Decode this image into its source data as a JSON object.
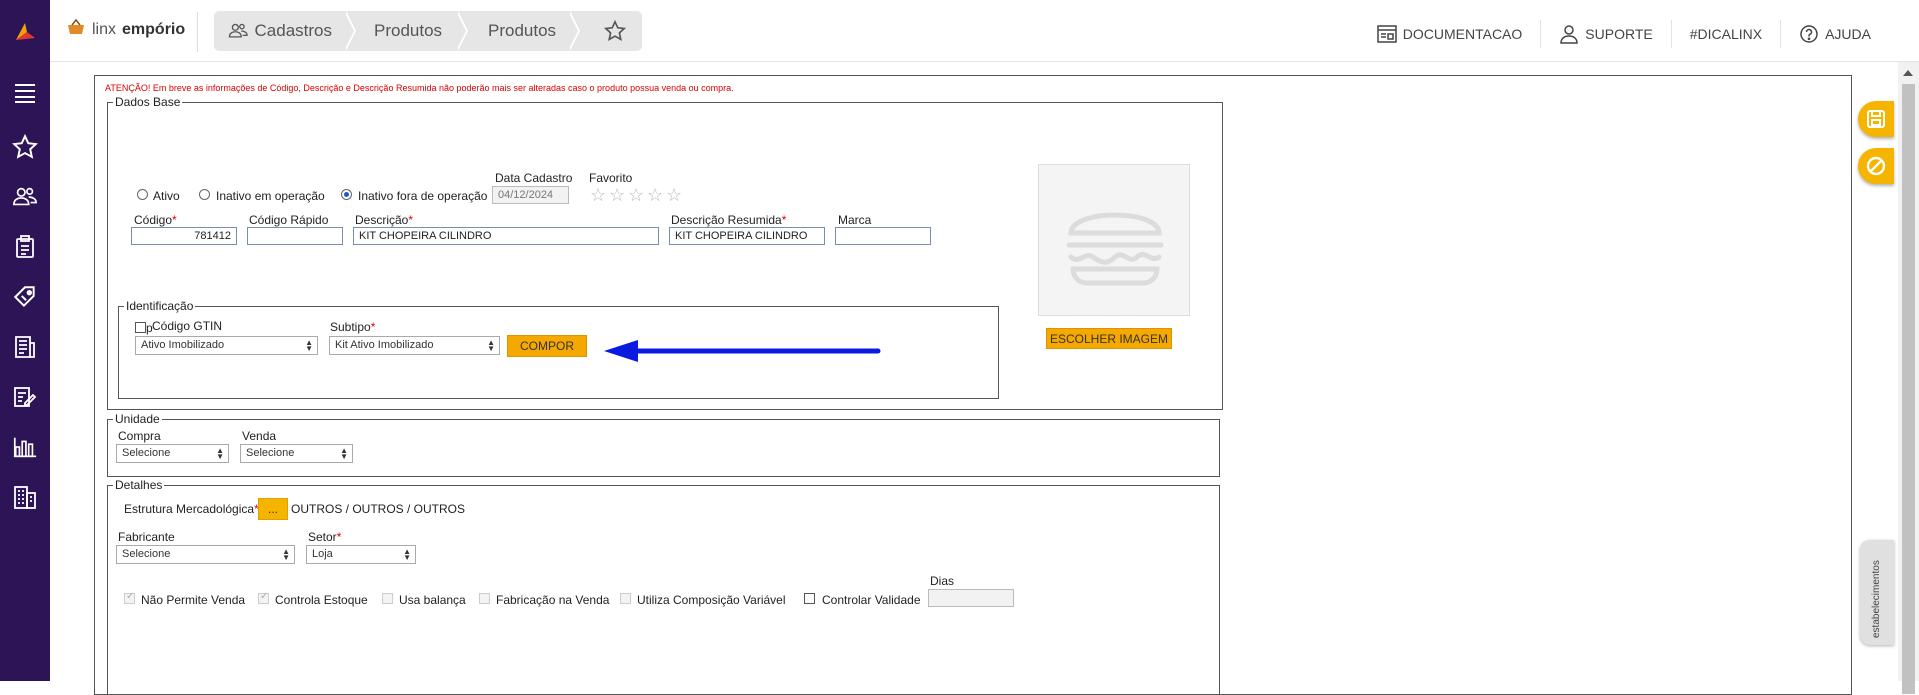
{
  "brand": {
    "name1": "linx",
    "name2": "empório"
  },
  "breadcrumbs": [
    "Cadastros",
    "Produtos",
    "Produtos"
  ],
  "top_actions": [
    "DOCUMENTACAO",
    "SUPORTE",
    "#DICALINX",
    "AJUDA"
  ],
  "sidebar": {
    "icons": [
      "menu-icon",
      "star-icon",
      "users-icon",
      "clipboard-icon",
      "tag-icon",
      "receipt-icon",
      "edit-form-icon",
      "bar-chart-icon",
      "building-icon"
    ]
  },
  "warning": "ATENÇÃO! Em breve as informações de Código, Descrição e Descrição Resumida não poderão mais ser alteradas caso o produto possua venda ou compra.",
  "dados_base": {
    "legend": "Dados Base",
    "status_options": [
      "Ativo",
      "Inativo em operação",
      "Inativo fora de operação"
    ],
    "status_selected": "Inativo fora de operação",
    "data_cadastro_label": "Data Cadastro",
    "data_cadastro_value": "04/12/2024",
    "favorito_label": "Favorito",
    "favorito_rating": 0,
    "codigo_label": "Código",
    "codigo_value": "781412",
    "codigo_rapido_label": "Código Rápido",
    "codigo_rapido_value": "",
    "descricao_label": "Descrição",
    "descricao_value": "KIT CHOPEIRA CILINDRO",
    "descricao_resumida_label": "Descrição Resumida",
    "descricao_resumida_value": "KIT CHOPEIRA CILINDRO",
    "marca_label": "Marca",
    "marca_value": "",
    "escolher_imagem": "ESCOLHER IMAGEM"
  },
  "identificacao": {
    "legend": "Identificação",
    "gtin_label": "Código GTIN",
    "gtin_overlap": "p",
    "tipo_value": "Ativo Imobilizado",
    "subtipo_label": "Subtipo",
    "subtipo_value": "Kit Ativo Imobilizado",
    "compor_label": "COMPOR"
  },
  "unidade": {
    "legend": "Unidade",
    "compra_label": "Compra",
    "compra_value": "Selecione",
    "venda_label": "Venda",
    "venda_value": "Selecione"
  },
  "detalhes": {
    "legend": "Detalhes",
    "estrutura_label": "Estrutura Mercadológica",
    "estrutura_btn": "...",
    "estrutura_value": "OUTROS / OUTROS / OUTROS",
    "fabricante_label": "Fabricante",
    "fabricante_value": "Selecione",
    "setor_label": "Setor",
    "setor_value": "Loja",
    "dias_label": "Dias",
    "dias_value": "",
    "checkboxes": [
      {
        "label": "Não Permite Venda",
        "checked": true,
        "disabled": true
      },
      {
        "label": "Controla Estoque",
        "checked": true,
        "disabled": true
      },
      {
        "label": "Usa balança",
        "checked": false,
        "disabled": true
      },
      {
        "label": "Fabricação na Venda",
        "checked": false,
        "disabled": true
      },
      {
        "label": "Utiliza Composição Variável",
        "checked": false,
        "disabled": true
      },
      {
        "label": "Controlar Validade",
        "checked": false,
        "disabled": false
      }
    ]
  },
  "side_tab": "estabelecimentos",
  "colors": {
    "sidebar": "#2d1457",
    "accent": "#f5a800",
    "required": "#dd0000",
    "arrow": "#0a1adf"
  }
}
